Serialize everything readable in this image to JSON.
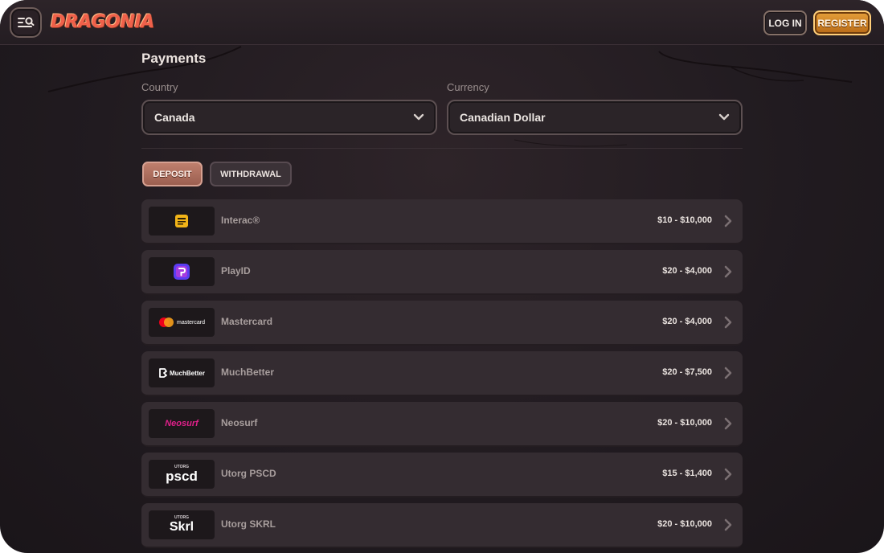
{
  "header": {
    "logo_text": "DRAGONIA",
    "menu_icon": "menu-search-icon",
    "login_label": "LOG IN",
    "register_label": "REGISTER",
    "accent_color": "#e69a34"
  },
  "page": {
    "title": "Payments",
    "country": {
      "label": "Country",
      "value": "Canada"
    },
    "currency": {
      "label": "Currency",
      "value": "Canadian Dollar"
    },
    "tabs": [
      {
        "label": "DEPOSIT",
        "active": true
      },
      {
        "label": "WITHDRAWAL",
        "active": false
      }
    ]
  },
  "methods": [
    {
      "name": "Interac®",
      "limit": "$10 - $10,000",
      "icon": "interac-logo"
    },
    {
      "name": "PlayID",
      "limit": "$20 - $4,000",
      "icon": "playid-logo"
    },
    {
      "name": "Mastercard",
      "limit": "$20 - $4,000",
      "icon": "mastercard-logo",
      "logo_text": "mastercard"
    },
    {
      "name": "MuchBetter",
      "limit": "$20 - $7,500",
      "icon": "muchbetter-logo",
      "logo_text": "MuchBetter"
    },
    {
      "name": "Neosurf",
      "limit": "$20 - $10,000",
      "icon": "neosurf-logo",
      "logo_text": "Neosurf"
    },
    {
      "name": "Utorg PSCD",
      "limit": "$15 - $1,400",
      "icon": "utorg-pscd-logo",
      "logo_tag": "UTORG",
      "logo_text": "pscd"
    },
    {
      "name": "Utorg SKRL",
      "limit": "$20 - $10,000",
      "icon": "utorg-skrl-logo",
      "logo_tag": "UTORG",
      "logo_text": "Skrl"
    }
  ]
}
